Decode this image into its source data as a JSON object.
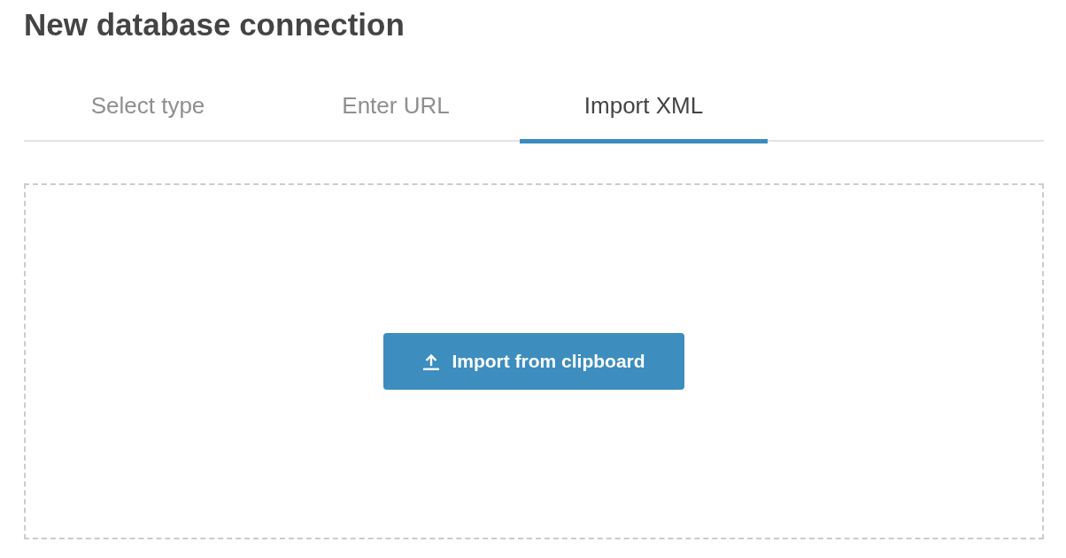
{
  "title": "New database connection",
  "tabs": [
    {
      "label": "Select type",
      "selected": false
    },
    {
      "label": "Enter URL",
      "selected": false
    },
    {
      "label": "Import XML",
      "selected": true
    }
  ],
  "dropzone": {
    "button": {
      "label": "Import from clipboard"
    }
  }
}
